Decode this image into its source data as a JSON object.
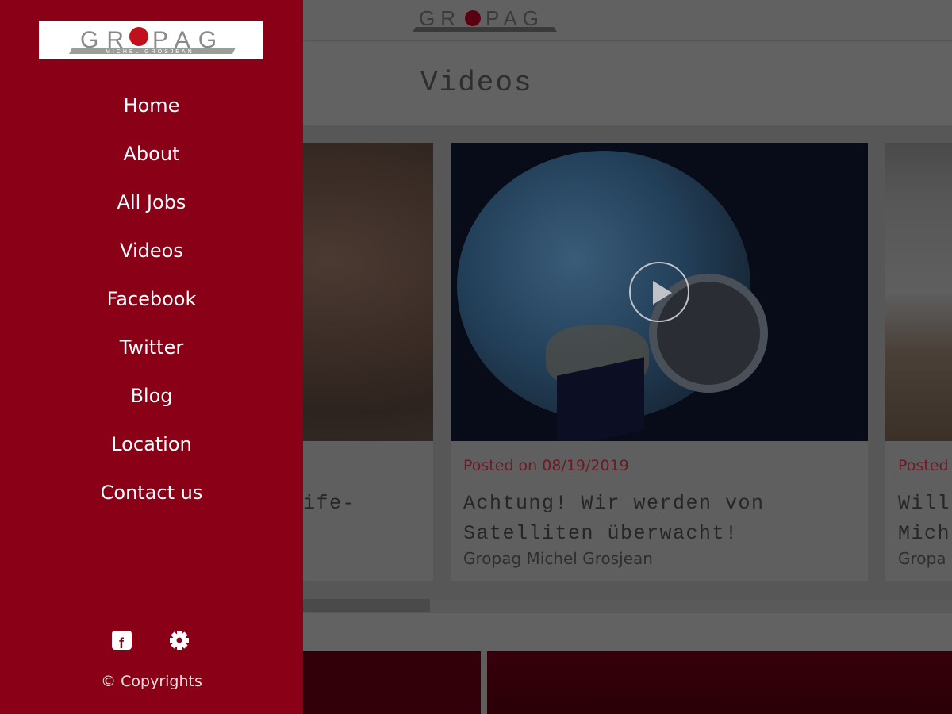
{
  "brand": {
    "logo_text": "GROPAG",
    "logo_subtext": "MICHEL GROSJEAN"
  },
  "page": {
    "title": "Videos"
  },
  "sidebar": {
    "items": [
      {
        "label": "Home"
      },
      {
        "label": "About"
      },
      {
        "label": "All Jobs"
      },
      {
        "label": "Videos"
      },
      {
        "label": "Facebook"
      },
      {
        "label": "Twitter"
      },
      {
        "label": "Blog"
      },
      {
        "label": "Location"
      },
      {
        "label": "Contact us"
      }
    ],
    "icons": [
      "facebook-icon",
      "gear-icon"
    ],
    "copyright": "© Copyrights"
  },
  "videos": [
    {
      "title_fragment": "ife-"
    },
    {
      "posted": "Posted on 08/19/2019",
      "title": "Achtung! Wir werden von Satelliten überwacht!",
      "author": "Gropag Michel Grosjean"
    },
    {
      "posted": "Posted",
      "title": "Will Mich",
      "author": "Gropa"
    }
  ],
  "colors": {
    "sidebar": "#8a0016",
    "accent": "#c0101c"
  }
}
